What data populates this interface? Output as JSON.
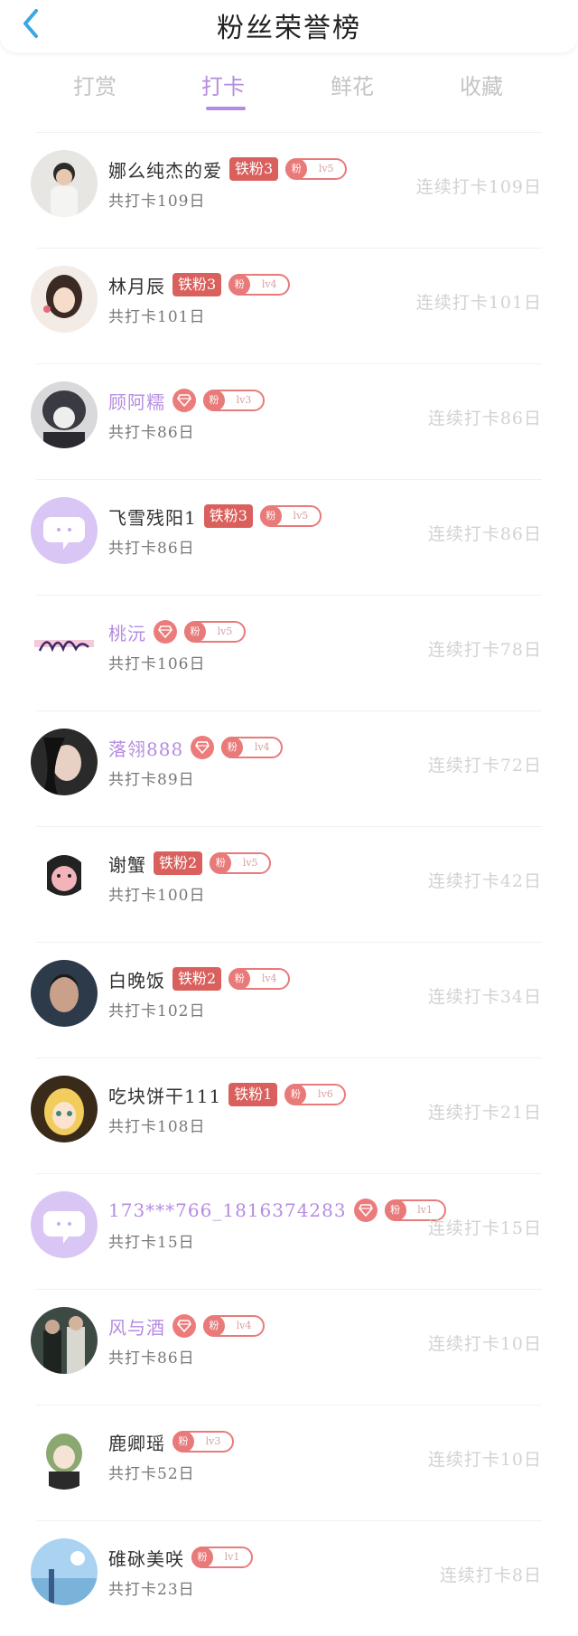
{
  "header": {
    "title": "粉丝荣誉榜"
  },
  "tabs": [
    {
      "label": "打赏",
      "active": false
    },
    {
      "label": "打卡",
      "active": true
    },
    {
      "label": "鲜花",
      "active": false
    },
    {
      "label": "收藏",
      "active": false
    }
  ],
  "colors": {
    "accent": "#b58ce0",
    "iron_badge": "#d9605c",
    "fan_pill": "#e97a7a",
    "streak_text": "#d2d2d2"
  },
  "fans": [
    {
      "name": "娜么纯杰的爱",
      "name_style": "default",
      "badge": "iron",
      "badge_label": "铁粉3",
      "pill_icon": "粉",
      "lv": "lv5",
      "total": "共打卡109日",
      "streak": "连续打卡109日",
      "avatar_icon": "person-photo"
    },
    {
      "name": "林月辰",
      "name_style": "default",
      "badge": "iron",
      "badge_label": "铁粉3",
      "pill_icon": "粉",
      "lv": "lv4",
      "total": "共打卡101日",
      "streak": "连续打卡101日",
      "avatar_icon": "anime-girl"
    },
    {
      "name": "顾阿糯",
      "name_style": "purple",
      "badge": "diamond",
      "badge_label": "",
      "pill_icon": "粉",
      "lv": "lv3",
      "total": "共打卡86日",
      "streak": "连续打卡86日",
      "avatar_icon": "dark-anime"
    },
    {
      "name": "飞雪残阳1",
      "name_style": "default",
      "badge": "iron",
      "badge_label": "铁粉3",
      "pill_icon": "粉",
      "lv": "lv5",
      "total": "共打卡86日",
      "streak": "连续打卡86日",
      "avatar_icon": "chat-bubble"
    },
    {
      "name": "桃沅",
      "name_style": "purple",
      "badge": "diamond",
      "badge_label": "",
      "pill_icon": "粉",
      "lv": "lv5",
      "total": "共打卡106日",
      "streak": "连续打卡78日",
      "avatar_icon": "calligraphy"
    },
    {
      "name": "落翎888",
      "name_style": "purple",
      "badge": "diamond",
      "badge_label": "",
      "pill_icon": "粉",
      "lv": "lv4",
      "total": "共打卡89日",
      "streak": "连续打卡72日",
      "avatar_icon": "dark-girl"
    },
    {
      "name": "谢蟹",
      "name_style": "default",
      "badge": "iron",
      "badge_label": "铁粉2",
      "pill_icon": "粉",
      "lv": "lv5",
      "total": "共打卡100日",
      "streak": "连续打卡42日",
      "avatar_icon": "cartoon-face"
    },
    {
      "name": "白晚饭",
      "name_style": "default",
      "badge": "iron",
      "badge_label": "铁粉2",
      "pill_icon": "粉",
      "lv": "lv4",
      "total": "共打卡102日",
      "streak": "连续打卡34日",
      "avatar_icon": "man-photo"
    },
    {
      "name": "吃块饼干111",
      "name_style": "default",
      "badge": "iron",
      "badge_label": "铁粉1",
      "pill_icon": "粉",
      "lv": "lv6",
      "total": "共打卡108日",
      "streak": "连续打卡21日",
      "avatar_icon": "blonde-anime"
    },
    {
      "name": "173***766_1816374283",
      "name_style": "purple",
      "badge": "diamond",
      "badge_label": "",
      "pill_icon": "粉",
      "lv": "lv1",
      "total": "共打卡15日",
      "streak": "连续打卡15日",
      "avatar_icon": "chat-bubble"
    },
    {
      "name": "风与酒",
      "name_style": "purple",
      "badge": "diamond",
      "badge_label": "",
      "pill_icon": "粉",
      "lv": "lv4",
      "total": "共打卡86日",
      "streak": "连续打卡10日",
      "avatar_icon": "couple-photo"
    },
    {
      "name": "鹿卿瑶",
      "name_style": "default",
      "badge": "none",
      "badge_label": "",
      "pill_icon": "粉",
      "lv": "lv3",
      "total": "共打卡52日",
      "streak": "连续打卡10日",
      "avatar_icon": "green-hair-anime"
    },
    {
      "name": "碓砯美咲",
      "name_style": "default",
      "badge": "none",
      "badge_label": "",
      "pill_icon": "粉",
      "lv": "lv1",
      "total": "共打卡23日",
      "streak": "连续打卡8日",
      "avatar_icon": "sky-scene"
    }
  ]
}
